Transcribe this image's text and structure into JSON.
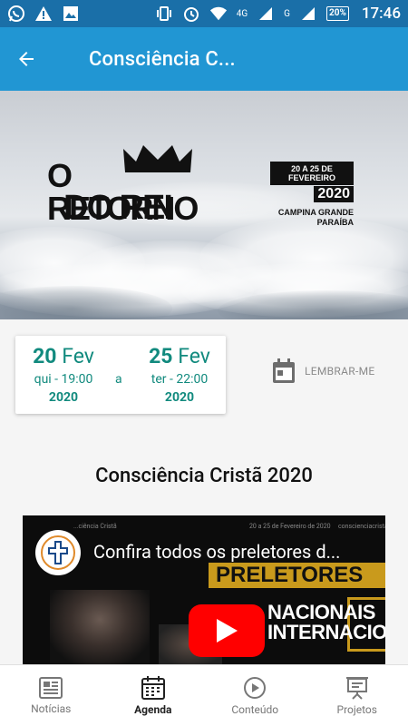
{
  "status_bar": {
    "time": "17:46",
    "battery": "20%",
    "network_1": "4G",
    "network_2": "G",
    "sim_1": "1",
    "sim_2": "2",
    "icons": [
      "whatsapp-icon",
      "warning-icon",
      "image-icon",
      "vibrate-icon",
      "alarm-icon",
      "wifi-icon",
      "signal-icon",
      "battery-icon"
    ]
  },
  "app_bar": {
    "title": "Consciência C..."
  },
  "banner": {
    "logo_line1": "O RETORNO",
    "logo_line2": "DO REI",
    "dates": "20 A 25 DE FEVEREIRO",
    "year": "2020",
    "city": "CAMPINA GRANDE",
    "state": "PARAÍBA"
  },
  "date_card": {
    "start_day": "20",
    "start_month": "Fev",
    "start_time": "qui - 19:00",
    "start_year": "2020",
    "separator": "a",
    "end_day": "25",
    "end_month": "Fev",
    "end_time": "ter - 22:00",
    "end_year": "2020"
  },
  "remind": {
    "label": "LEMBRAR-ME"
  },
  "event_title": "Consciência Cristã 2020",
  "video": {
    "title": "Confira todos os preletores d...",
    "top_left": "...ciência Cristã",
    "top_mid": "20 a 25 de Fevereiro de 2020",
    "top_right": "conscienciacrista",
    "banner_text": "PRELETORES",
    "line1": "NACIONAIS",
    "line2": "INTERNACIONAIS"
  },
  "bottom_nav": {
    "items": [
      {
        "label": "Notícias",
        "icon": "newspaper-icon"
      },
      {
        "label": "Agenda",
        "icon": "calendar-icon"
      },
      {
        "label": "Conteúdo",
        "icon": "play-circle-icon"
      },
      {
        "label": "Projetos",
        "icon": "presentation-icon"
      }
    ],
    "active": "Agenda"
  },
  "colors": {
    "status_bar": "#1a6fa8",
    "app_bar": "#2196d3",
    "date_accent": "#118a7e",
    "youtube_red": "#ff0000",
    "gold": "#c99a1c"
  }
}
